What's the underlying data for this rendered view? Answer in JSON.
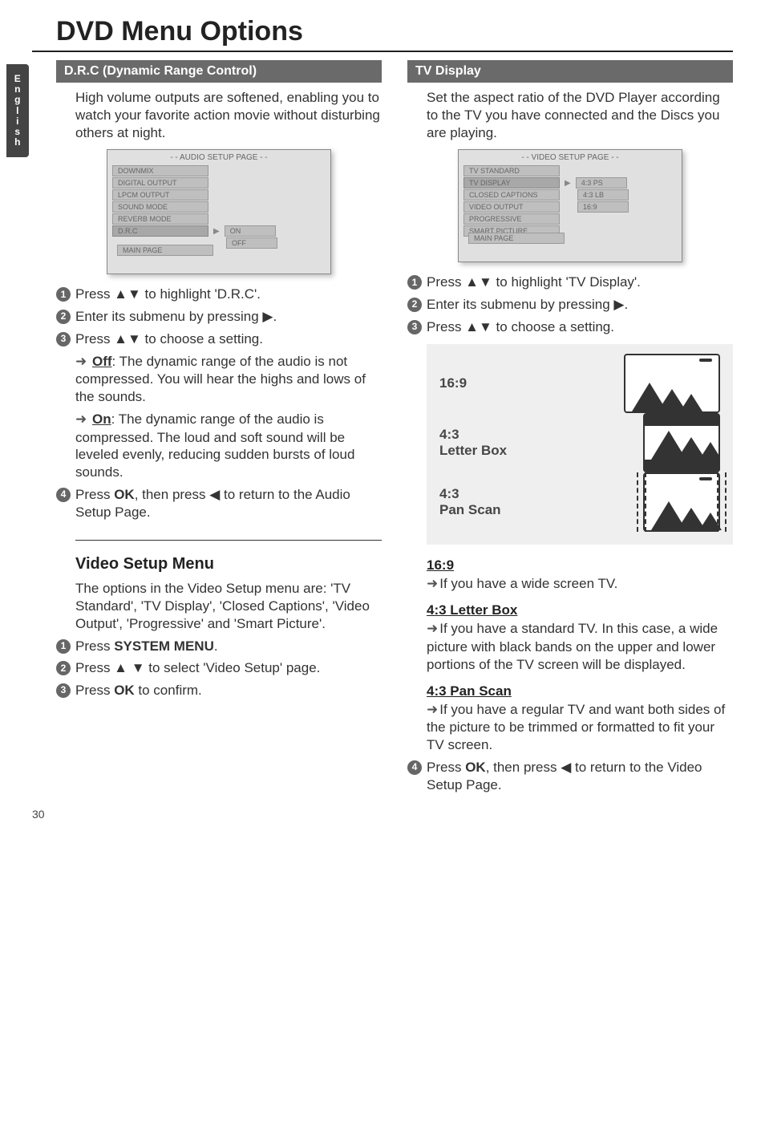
{
  "page_number": "30",
  "side_tab": "English",
  "title": "DVD Menu Options",
  "left": {
    "drc": {
      "heading": "D.R.C (Dynamic Range Control)",
      "intro": "High volume outputs are softened, enabling you to watch your favorite action movie without disturbing others at night.",
      "osd": {
        "title": "- - AUDIO SETUP PAGE - -",
        "items": [
          "DOWNMIX",
          "DIGITAL OUTPUT",
          "LPCM OUTPUT",
          "SOUND MODE",
          "REVERB MODE",
          "D.R.C"
        ],
        "options": [
          "ON",
          "OFF"
        ],
        "main_page": "MAIN PAGE"
      },
      "steps": {
        "s1": "Press ▲▼ to highlight 'D.R.C'.",
        "s2": "Enter its submenu by pressing ▶.",
        "s3": "Press ▲▼ to choose a setting.",
        "off_label": "Off",
        "off_body": ": The dynamic range of the audio is not compressed. You will hear the highs and lows of the sounds.",
        "on_label": "On",
        "on_body": ": The dynamic range of the audio is compressed. The loud and soft sound will be leveled evenly, reducing sudden bursts of loud sounds.",
        "s4_pre": "Press ",
        "s4_ok": "OK",
        "s4_mid": ", then press ◀ to return to the Audio Setup Page."
      }
    },
    "video_setup": {
      "heading": "Video Setup Menu",
      "intro": "The options in the Video Setup menu are: 'TV Standard', 'TV Display', 'Closed Captions', 'Video Output', 'Progressive' and 'Smart Picture'.",
      "s1_pre": "Press ",
      "s1_b": "SYSTEM MENU",
      "s1_post": ".",
      "s2": "Press ▲ ▼ to select 'Video Setup' page.",
      "s3_pre": "Press ",
      "s3_b": "OK",
      "s3_post": " to confirm."
    }
  },
  "right": {
    "tvdisp": {
      "heading": "TV Display",
      "intro": "Set the aspect ratio of the DVD Player according to the TV you have connected and the Discs you are playing.",
      "osd": {
        "title": "- - VIDEO SETUP PAGE - -",
        "items": [
          "TV STANDARD",
          "TV DISPLAY",
          "CLOSED CAPTIONS",
          "VIDEO OUTPUT",
          "PROGRESSIVE",
          "SMART PICTURE"
        ],
        "options": [
          "4:3 PS",
          "4:3 LB",
          "16:9"
        ],
        "main_page": "MAIN PAGE"
      },
      "s1": "Press ▲▼ to highlight 'TV Display'.",
      "s2": "Enter its submenu by pressing ▶.",
      "s3": "Press ▲▼ to choose a setting.",
      "aspects": {
        "a1": "16:9",
        "a2a": "4:3",
        "a2b": "Letter Box",
        "a3a": "4:3",
        "a3b": "Pan Scan"
      },
      "opt169_h": "16:9",
      "opt169_b": "If you have a wide screen TV.",
      "optlb_h": "4:3 Letter Box",
      "optlb_b": "If you have a standard TV. In this case, a wide picture with black bands on the upper and lower portions of the TV screen will be displayed.",
      "optps_h": "4:3 Pan Scan",
      "optps_b": "If you have a regular TV and want both sides of the picture to be trimmed or formatted to fit your TV screen.",
      "s4_pre": "Press ",
      "s4_ok": "OK",
      "s4_mid": ", then press ◀ to return to the Video Setup Page."
    }
  }
}
